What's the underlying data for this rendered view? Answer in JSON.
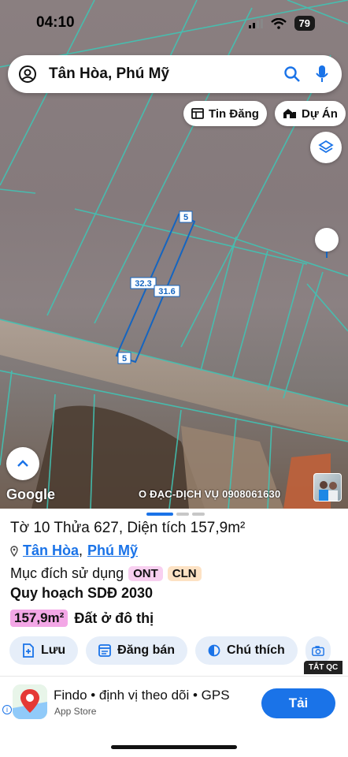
{
  "status": {
    "time": "04:10",
    "battery": "79"
  },
  "search": {
    "query": "Tân Hòa, Phú Mỹ"
  },
  "map_chips": {
    "news": "Tin Đăng",
    "projects": "Dự Án"
  },
  "parcel_labels": {
    "top": "5",
    "bottom": "5",
    "left": "32.3",
    "right": "31.6"
  },
  "map": {
    "provider": "Google",
    "credit": "O ĐẠC-DỊCH VỤ 0908061630"
  },
  "info": {
    "title": "Tờ 10 Thửa 627, Diện tích 157,9m²",
    "location_ward": "Tân Hòa",
    "location_sep": ",",
    "location_district": "Phú Mỹ",
    "purpose_label": "Mục đích sử dụng",
    "purpose_tags": [
      "ONT",
      "CLN"
    ],
    "plan_label": "Quy hoạch SDĐ 2030",
    "plan_area": "157,9m²",
    "plan_zone": "Đất ở đô thị"
  },
  "actions": {
    "save": "Lưu",
    "post": "Đăng bán",
    "legend": "Chú thích"
  },
  "ad": {
    "badge": "TẮT QC",
    "title": "Findo • định vị theo dõi • GPS",
    "source": "App Store",
    "install": "Tải"
  },
  "colors": {
    "accent": "#1a73e8",
    "parcel_outline": "#1565c0",
    "grid_lines": "#41c3b4"
  }
}
